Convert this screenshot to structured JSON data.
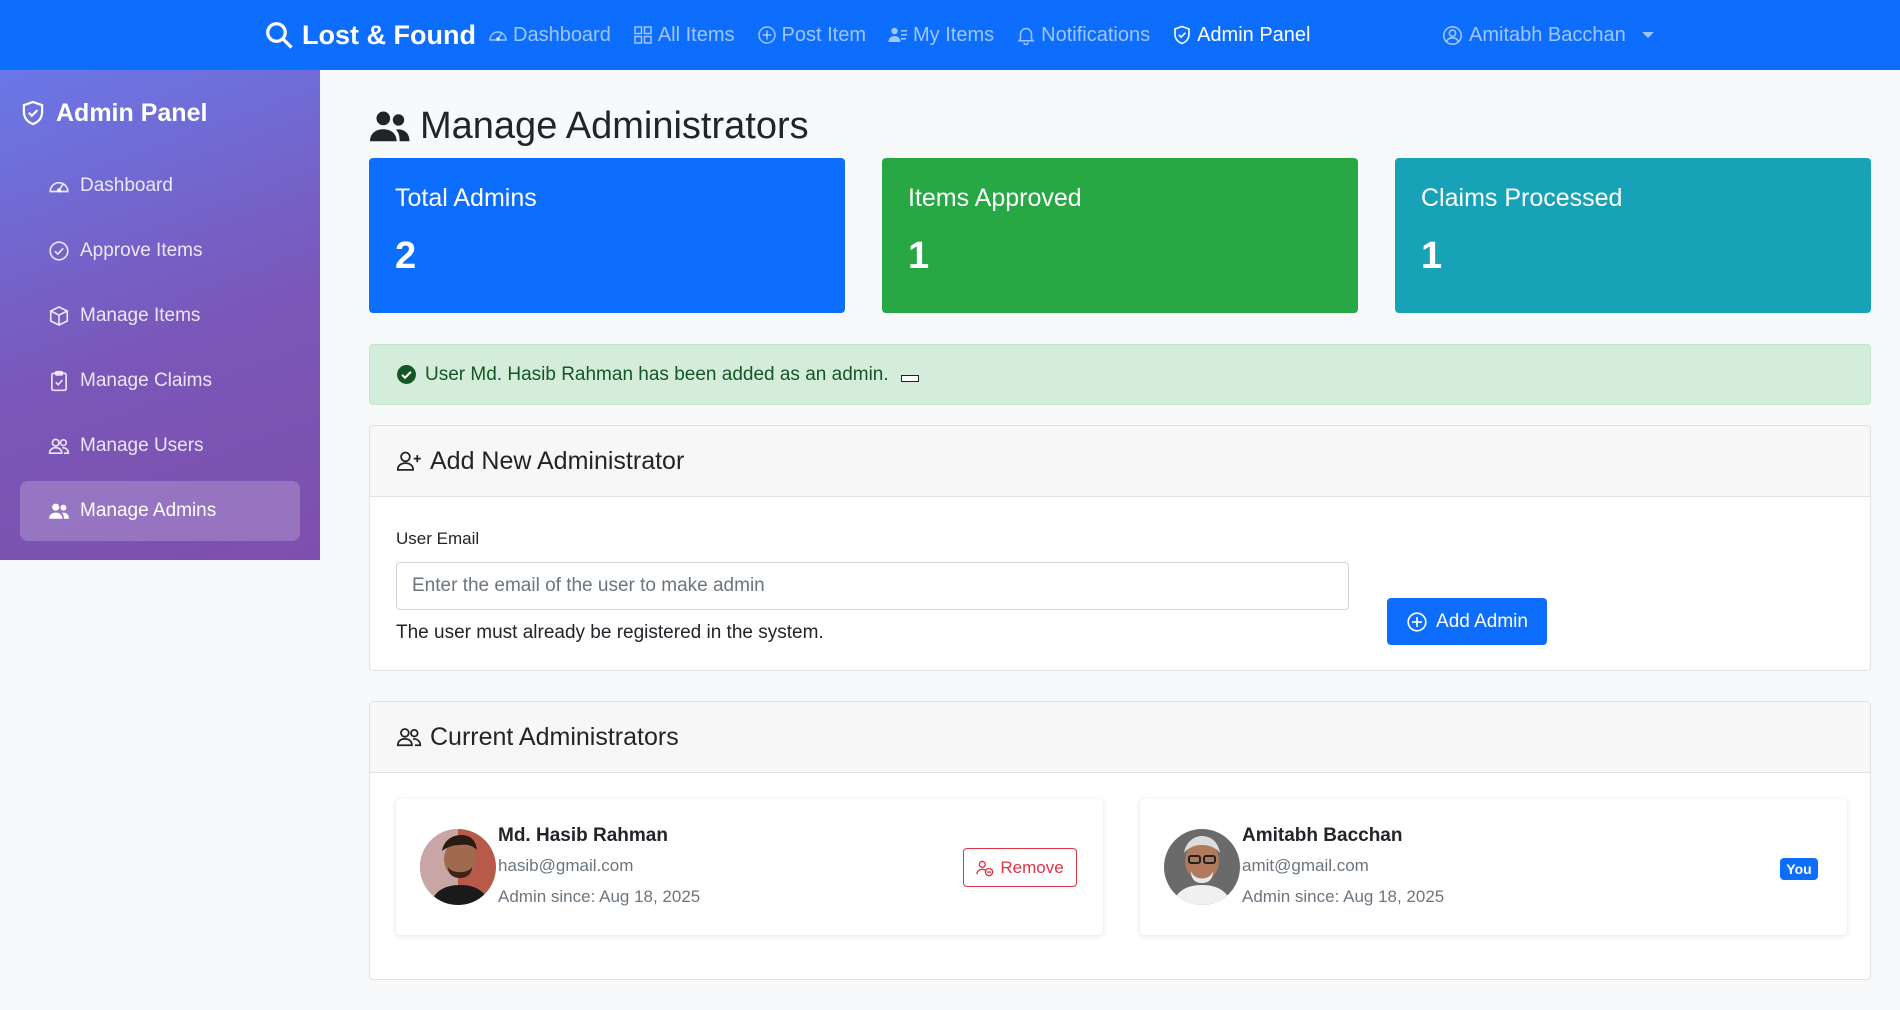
{
  "navbar": {
    "brand": "Lost & Found",
    "links": [
      {
        "label": "Dashboard",
        "icon": "speedometer-icon"
      },
      {
        "label": "All Items",
        "icon": "grid-icon"
      },
      {
        "label": "Post Item",
        "icon": "plus-circle-icon"
      },
      {
        "label": "My Items",
        "icon": "person-lines-icon"
      },
      {
        "label": "Notifications",
        "icon": "bell-icon"
      },
      {
        "label": "Admin Panel",
        "icon": "shield-check-icon",
        "active": true
      }
    ],
    "user": "Amitabh Bacchan"
  },
  "sidebar": {
    "title": "Admin Panel",
    "items": [
      {
        "label": "Dashboard",
        "icon": "speedometer-icon"
      },
      {
        "label": "Approve Items",
        "icon": "check-circle-icon"
      },
      {
        "label": "Manage Items",
        "icon": "box-icon"
      },
      {
        "label": "Manage Claims",
        "icon": "clipboard-check-icon"
      },
      {
        "label": "Manage Users",
        "icon": "people-icon"
      },
      {
        "label": "Manage Admins",
        "icon": "people-fill-icon",
        "active": true
      }
    ]
  },
  "page": {
    "title": "Manage Administrators"
  },
  "stats": [
    {
      "label": "Total Admins",
      "value": "2",
      "color": "#0d6efd"
    },
    {
      "label": "Items Approved",
      "value": "1",
      "color": "#28a745"
    },
    {
      "label": "Claims Processed",
      "value": "1",
      "color": "#17a2b8"
    }
  ],
  "alert": {
    "message": "User Md. Hasib Rahman has been added as an admin."
  },
  "add_form": {
    "title": "Add New Administrator",
    "field_label": "User Email",
    "placeholder": "Enter the email of the user to make admin",
    "help": "The user must already be registered in the system.",
    "button": "Add Admin"
  },
  "admins": {
    "title": "Current Administrators",
    "list": [
      {
        "name": "Md. Hasib Rahman",
        "email": "hasib@gmail.com",
        "since": "Admin since: Aug 18, 2025",
        "action": "Remove"
      },
      {
        "name": "Amitabh Bacchan",
        "email": "amit@gmail.com",
        "since": "Admin since: Aug 18, 2025",
        "badge": "You"
      }
    ]
  },
  "colors": {
    "primary": "#0d6efd",
    "success": "#28a745",
    "info": "#17a2b8",
    "danger": "#dc3545",
    "alert_bg": "#d4edda"
  }
}
